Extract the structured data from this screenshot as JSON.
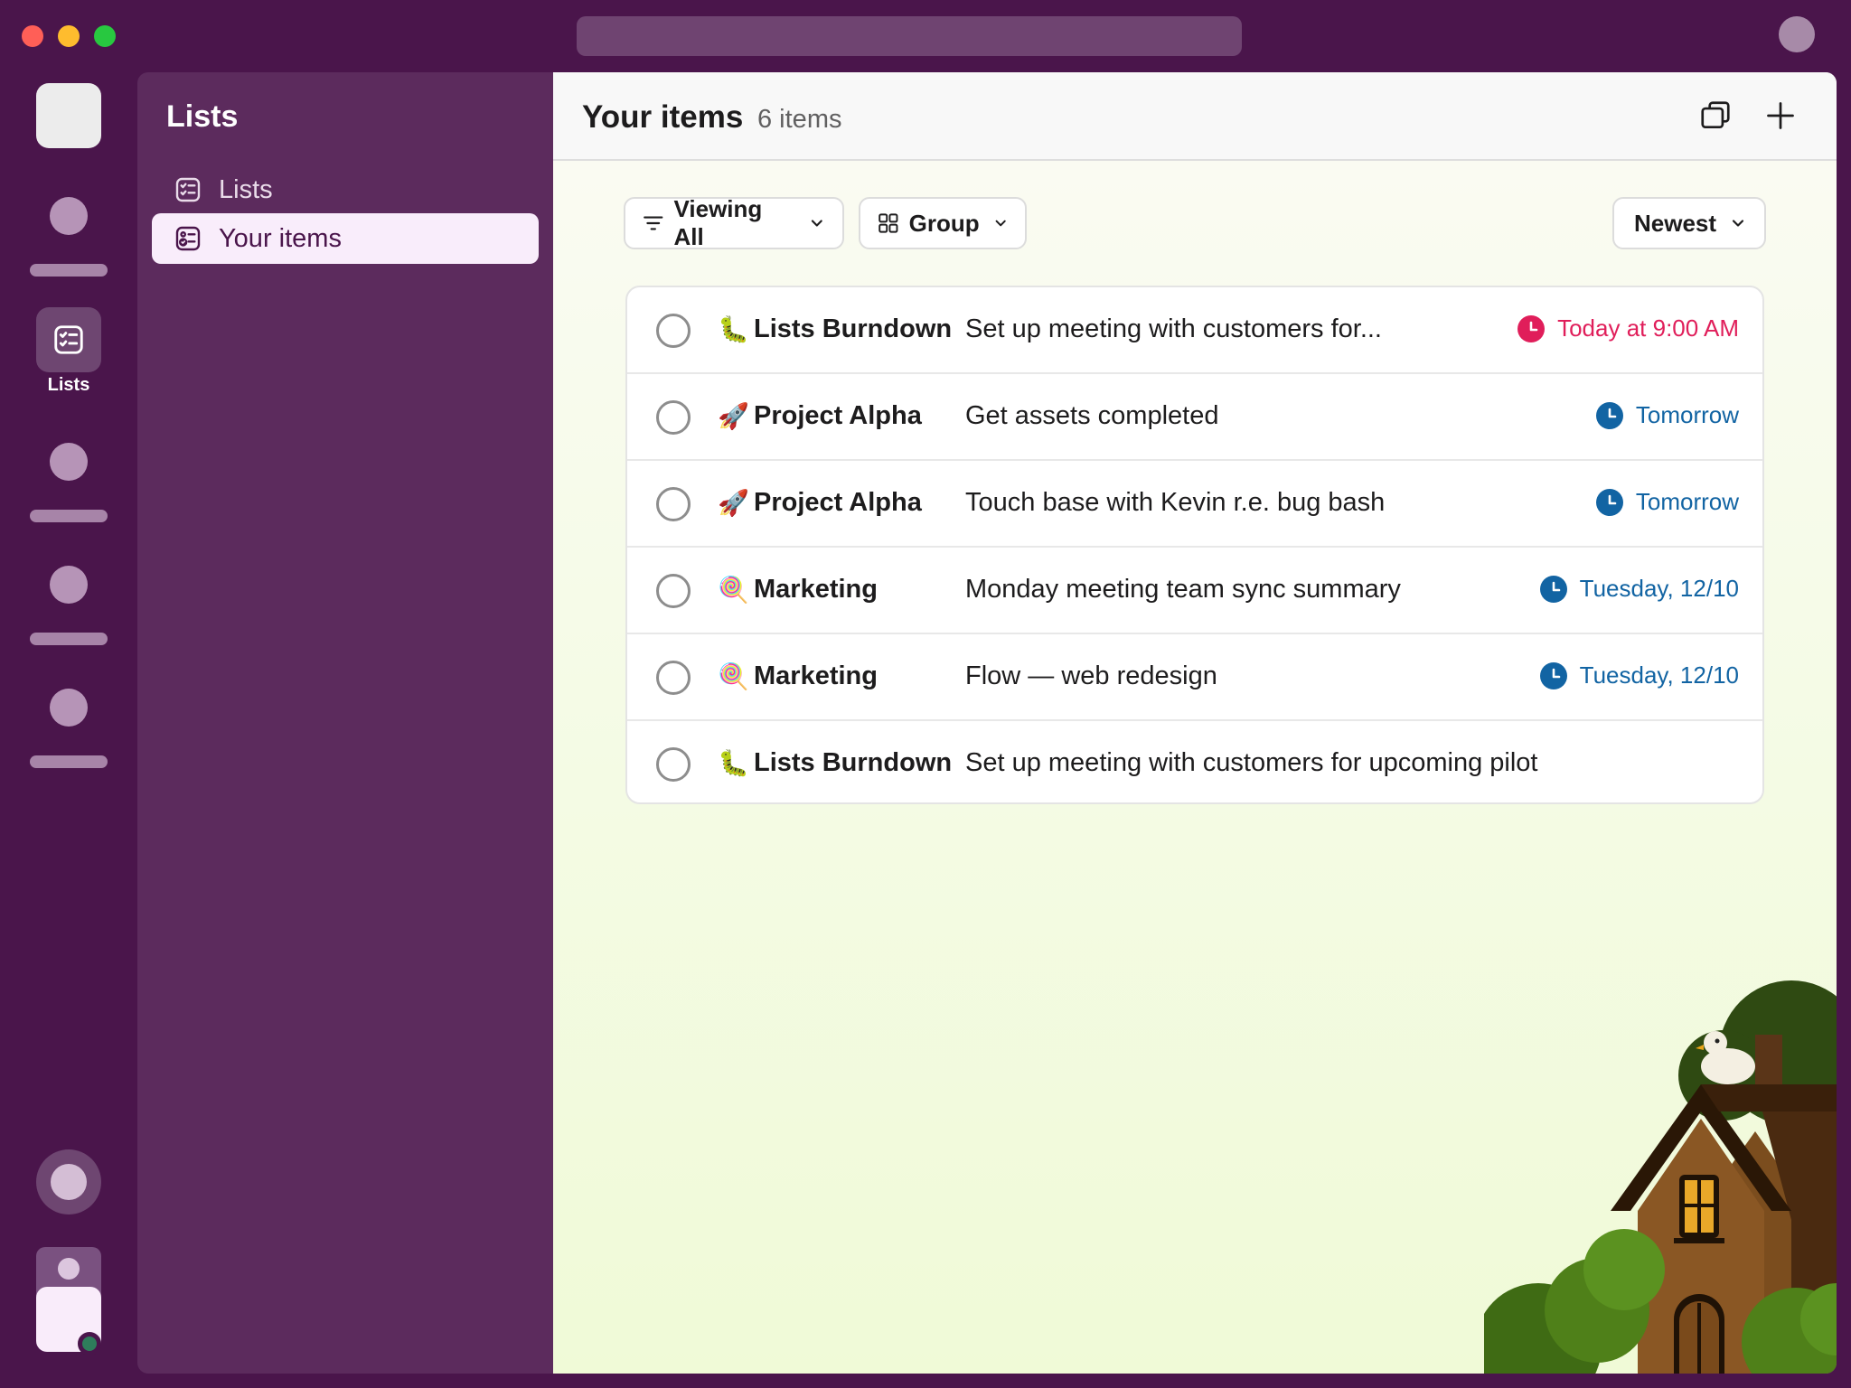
{
  "window": {
    "traffic_lights": [
      "close",
      "minimize",
      "zoom"
    ]
  },
  "rail": {
    "lists_label": "Lists"
  },
  "sidebar": {
    "title": "Lists",
    "items": [
      {
        "label": "Lists",
        "icon": "checklist-icon",
        "active": false
      },
      {
        "label": "Your items",
        "icon": "checklist-person-icon",
        "active": true
      }
    ]
  },
  "main": {
    "title": "Your items",
    "count": "6 items",
    "filters": {
      "viewing": "Viewing All",
      "group": "Group",
      "sort": "Newest"
    },
    "rows": [
      {
        "emoji": "🐛",
        "list": "Lists Burndown",
        "title": "Set up meeting with customers for...",
        "due": "Today at 9:00 AM",
        "due_color": "#e01e5a"
      },
      {
        "emoji": "🚀",
        "list": "Project Alpha",
        "title": "Get assets completed",
        "due": "Tomorrow",
        "due_color": "#1264a3"
      },
      {
        "emoji": "🚀",
        "list": "Project Alpha",
        "title": "Touch base with Kevin r.e. bug bash",
        "due": "Tomorrow",
        "due_color": "#1264a3"
      },
      {
        "emoji": "🍭",
        "list": "Marketing",
        "title": "Monday meeting team sync summary",
        "due": "Tuesday, 12/10",
        "due_color": "#1264a3"
      },
      {
        "emoji": "🍭",
        "list": "Marketing",
        "title": "Flow — web redesign",
        "due": "Tuesday, 12/10",
        "due_color": "#1264a3"
      },
      {
        "emoji": "🐛",
        "list": "Lists Burndown",
        "title": "Set up meeting with customers for upcoming pilot",
        "due": "",
        "due_color": ""
      }
    ]
  },
  "colors": {
    "aubergine": "#4a154b",
    "sidebar": "#5c2b5d",
    "overdue": "#e01e5a",
    "upcoming": "#1264a3"
  }
}
